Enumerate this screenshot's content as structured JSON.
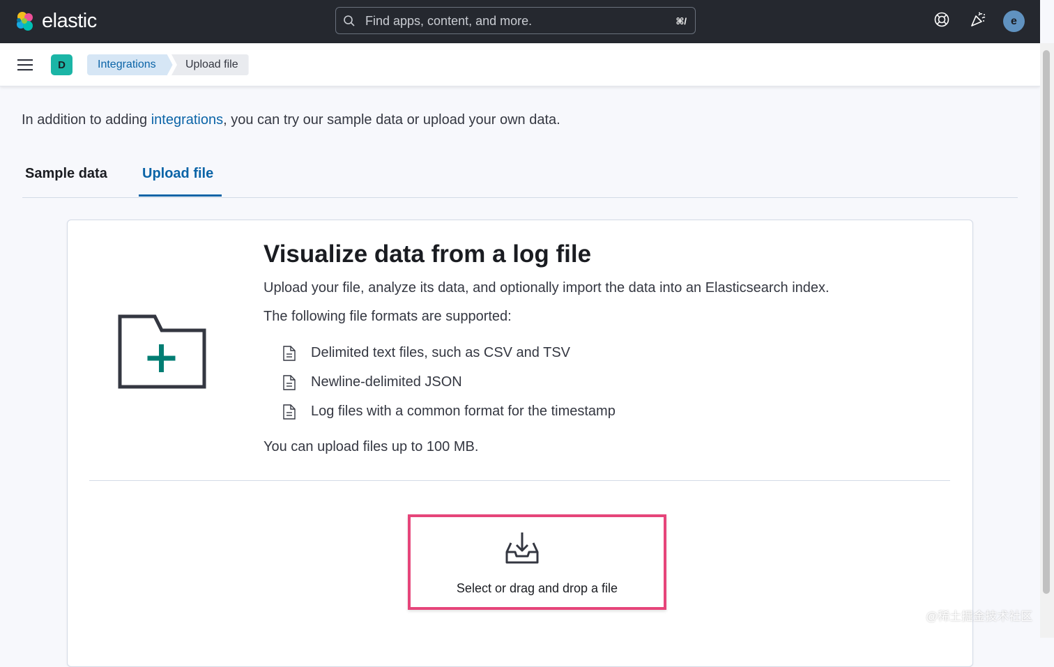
{
  "header": {
    "brand": "elastic",
    "search_placeholder": "Find apps, content, and more.",
    "search_shortcut": "⌘/",
    "avatar_initial": "e",
    "icons": [
      "help-icon",
      "news-feed-icon"
    ]
  },
  "subnav": {
    "space_initial": "D",
    "breadcrumbs": [
      "Integrations",
      "Upload file"
    ]
  },
  "intro": {
    "before": "In addition to adding ",
    "link": "integrations",
    "after": ", you can try our sample data or upload your own data."
  },
  "tabs": [
    {
      "label": "Sample data",
      "selected": false
    },
    {
      "label": "Upload file",
      "selected": true
    }
  ],
  "panel": {
    "title": "Visualize data from a log file",
    "description": "Upload your file, analyze its data, and optionally import the data into an Elasticsearch index.",
    "formats_intro": "The following file formats are supported:",
    "formats": [
      "Delimited text files, such as CSV and TSV",
      "Newline-delimited JSON",
      "Log files with a common format for the timestamp"
    ],
    "limit": "You can upload files up to 100 MB.",
    "dropzone_label": "Select or drag and drop a file"
  },
  "watermark": "@稀土掘金技术社区",
  "colors": {
    "header_bg": "#25282f",
    "link": "#0b64a7",
    "highlight": "#e6457a",
    "folder_plus": "#017d73"
  }
}
